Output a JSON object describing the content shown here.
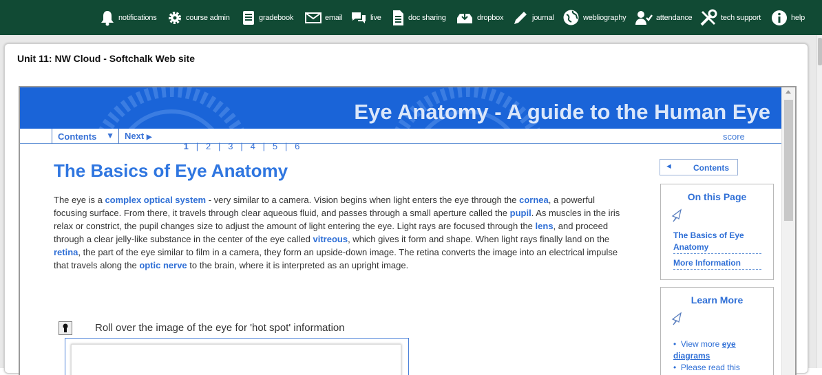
{
  "topnav": [
    {
      "label": "notifications",
      "icon": "bell-icon"
    },
    {
      "label": "course admin",
      "icon": "gear-icon"
    },
    {
      "label": "gradebook",
      "icon": "gradebook-icon"
    },
    {
      "label": "email",
      "icon": "envelope-icon"
    },
    {
      "label": "live",
      "icon": "chat-bubbles-icon"
    },
    {
      "label": "doc sharing",
      "icon": "document-icon"
    },
    {
      "label": "dropbox",
      "icon": "dropbox-tray-icon"
    },
    {
      "label": "journal",
      "icon": "pen-icon"
    },
    {
      "label": "webliography",
      "icon": "globe-icon"
    },
    {
      "label": "attendance",
      "icon": "person-check-icon"
    },
    {
      "label": "tech support",
      "icon": "tools-icon"
    },
    {
      "label": "help",
      "icon": "info-circle-icon"
    }
  ],
  "page": {
    "title": "Unit 11: NW Cloud - Softchalk Web site"
  },
  "lesson": {
    "banner_title": "Eye Anatomy - A guide to the Human Eye",
    "nav": {
      "contents_label": "Contents",
      "contents_arrow": "▼",
      "next_label": "Next",
      "next_arrow": "▶",
      "pages": [
        "1",
        "2",
        "3",
        "4",
        "5",
        "6"
      ],
      "score_label": "score"
    },
    "heading": "The Basics of Eye Anatomy",
    "body": {
      "p1": "The eye is a ",
      "k1": "complex optical system",
      "p2": " - very similar to a camera. Vision begins when light enters the eye through the ",
      "k2": "cornea",
      "p3": ", a powerful focusing surface. From there, it travels through clear aqueous fluid, and passes through a small aperture called the ",
      "k3": "pupil",
      "p4": ". As muscles in the iris relax or constrict, the pupil changes size to adjust the amount of light entering the eye. Light rays are focused through the ",
      "k4": "lens",
      "p5": ", and proceed through a clear jelly-like substance in the center of the eye called ",
      "k5": "vitreous",
      "p6": ", which gives it form and shape. When light rays finally land on the ",
      "k6": "retina",
      "p7": ", the part of the eye similar to film in a camera, they form an upside-down image. The retina converts the image into an electrical impulse that travels along the ",
      "k7": "optic nerve",
      "p8": " to the brain, where it is interpreted as an upright image."
    },
    "rollover_instruction": "Roll over the image of the eye for 'hot spot' information",
    "sidebar": {
      "contents_arrow": "◄",
      "contents_label": "Contents",
      "on_this_page": {
        "title": "On this Page",
        "links": [
          "The Basics of Eye Anatomy",
          "More Information"
        ]
      },
      "learn_more": {
        "title": "Learn More",
        "item1_prefix": "View more ",
        "item1_link": "eye diagrams",
        "item2": "Please read this"
      }
    }
  },
  "colors": {
    "topbar": "#114a34",
    "banner": "#1a64d8",
    "accent": "#2f76e0"
  }
}
